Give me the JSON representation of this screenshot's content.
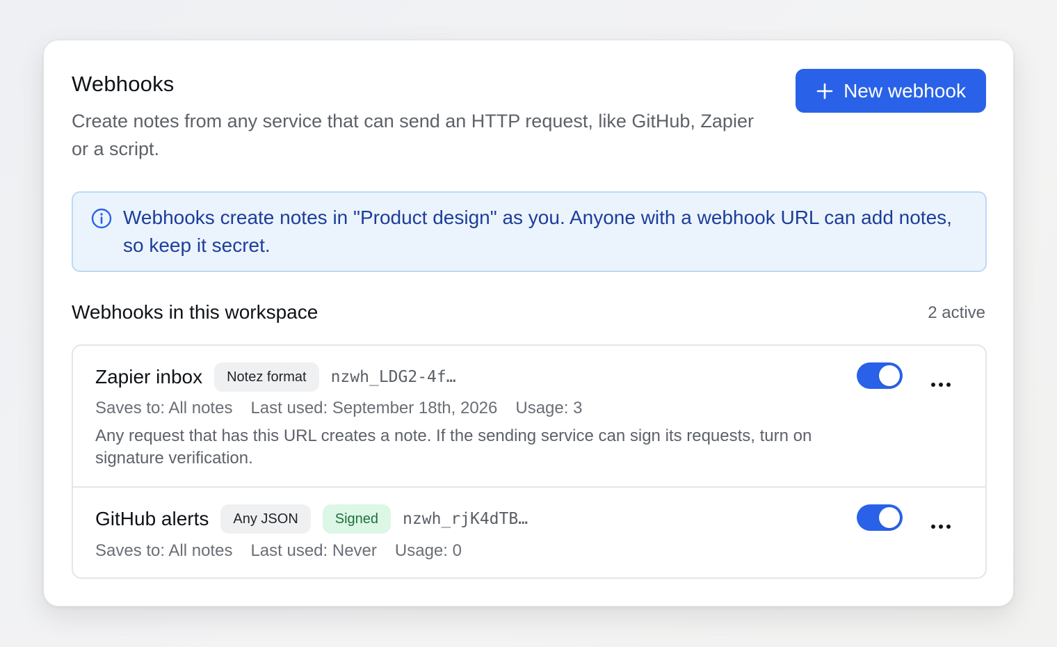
{
  "header": {
    "title": "Webhooks",
    "subtitle": "Create notes from any service that can send an HTTP request, like GitHub, Zapier or a script.",
    "new_button_label": "New webhook"
  },
  "info": {
    "text": "Webhooks create notes in \"Product design\" as you. Anyone with a webhook URL can add notes, so keep it secret."
  },
  "section": {
    "title": "Webhooks in this workspace",
    "active_count": "2 active"
  },
  "webhooks": [
    {
      "name": "Zapier inbox",
      "format_badge": "Notez format",
      "token": "nzwh_LDG2-4f…",
      "saves_to": "Saves to: All notes",
      "last_used": "Last used: September 18th, 2026",
      "usage": "Usage: 3",
      "description": "Any request that has this URL creates a note. If the sending service can sign its requests, turn on signature verification.",
      "enabled": true
    },
    {
      "name": "GitHub alerts",
      "format_badge": "Any JSON",
      "signed_badge": "Signed",
      "token": "nzwh_rjK4dTB…",
      "saves_to": "Saves to: All notes",
      "last_used": "Last used: Never",
      "usage": "Usage: 0",
      "enabled": true
    }
  ],
  "colors": {
    "accent": "#2962e8",
    "info_bg": "#ebf4fd",
    "info_text": "#1d3d9a",
    "signed_bg": "#dcf7e6"
  },
  "icons": {
    "new_button": "plus-icon",
    "info": "info-circle-icon",
    "row_menu": "more-horizontal-icon"
  }
}
